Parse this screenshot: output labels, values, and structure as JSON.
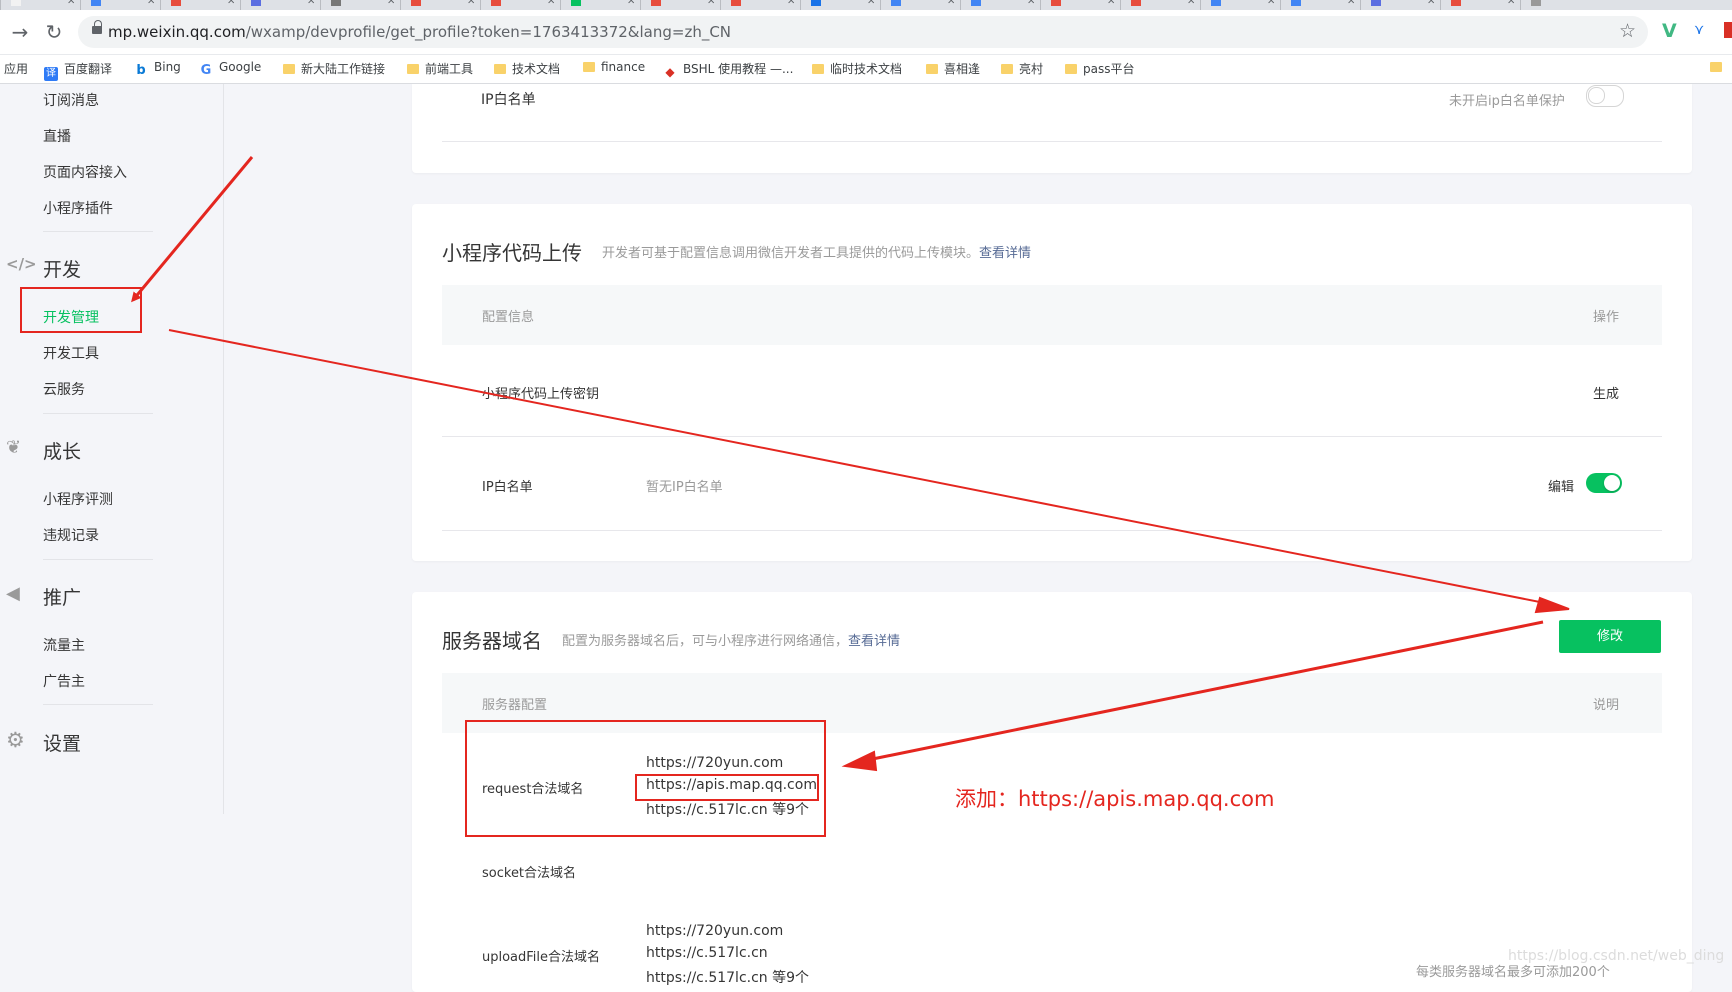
{
  "browser": {
    "url_domain": "mp.weixin.qq.com",
    "url_path": "/wxamp/devprofile/get_profile?token=1763413372&lang=zh_CN",
    "bookmarks": [
      {
        "label": "应用",
        "icon": "apps-grid-icon"
      },
      {
        "label": "百度翻译",
        "icon": "baidu-translate-icon"
      },
      {
        "label": "Bing",
        "icon": "bing-icon"
      },
      {
        "label": "Google",
        "icon": "google-icon"
      },
      {
        "label": "新大陆工作链接",
        "icon": "folder-icon"
      },
      {
        "label": "前端工具",
        "icon": "folder-icon"
      },
      {
        "label": "技术文档",
        "icon": "folder-icon"
      },
      {
        "label": "finance",
        "icon": "folder-icon"
      },
      {
        "label": "BSHL 使用教程 —...",
        "icon": "bshl-icon"
      },
      {
        "label": "临时技术文档",
        "icon": "folder-icon"
      },
      {
        "label": "喜相逢",
        "icon": "folder-icon"
      },
      {
        "label": "亮村",
        "icon": "folder-icon"
      },
      {
        "label": "pass平台",
        "icon": "folder-icon"
      }
    ]
  },
  "sidebar": {
    "items_top": [
      "订阅消息",
      "直播",
      "页面内容接入",
      "小程序插件"
    ],
    "section_dev": "开发",
    "items_dev": [
      "开发管理",
      "开发工具",
      "云服务"
    ],
    "section_growth": "成长",
    "items_growth": [
      "小程序评测",
      "违规记录"
    ],
    "section_promo": "推广",
    "items_promo": [
      "流量主",
      "广告主"
    ],
    "section_settings": "设置"
  },
  "card_ip": {
    "label": "IP白名单",
    "status": "未开启ip白名单保护"
  },
  "card_upload": {
    "title": "小程序代码上传",
    "desc": "开发者可基于配置信息调用微信开发者工具提供的代码上传模块。",
    "desc_link": "查看详情",
    "col_config": "配置信息",
    "col_action": "操作",
    "row1_label": "小程序代码上传密钥",
    "row1_action": "生成",
    "row2_label": "IP白名单",
    "row2_value": "暂无IP白名单",
    "row2_action": "编辑"
  },
  "card_server": {
    "title": "服务器域名",
    "desc": "配置为服务器域名后，可与小程序进行网络通信，",
    "desc_link": "查看详情",
    "edit_button": "修改",
    "col_config": "服务器配置",
    "col_note": "说明",
    "request_label": "request合法域名",
    "request_domains": [
      "https://720yun.com",
      "https://apis.map.qq.com",
      "https://c.517lc.cn 等9个"
    ],
    "socket_label": "socket合法域名",
    "upload_label": "uploadFile合法域名",
    "upload_domains": [
      "https://720yun.com",
      "https://c.517lc.cn",
      "https://c.517lc.cn 等9个"
    ],
    "footnote": "每类服务器域名最多可添加200个"
  },
  "annotation": "添加：https://apis.map.qq.com",
  "watermark": "https://blog.csdn.net/web_ding",
  "colors": {
    "accent_green": "#07c160",
    "annotation_red": "#e4261f",
    "link_blue": "#576b95"
  }
}
